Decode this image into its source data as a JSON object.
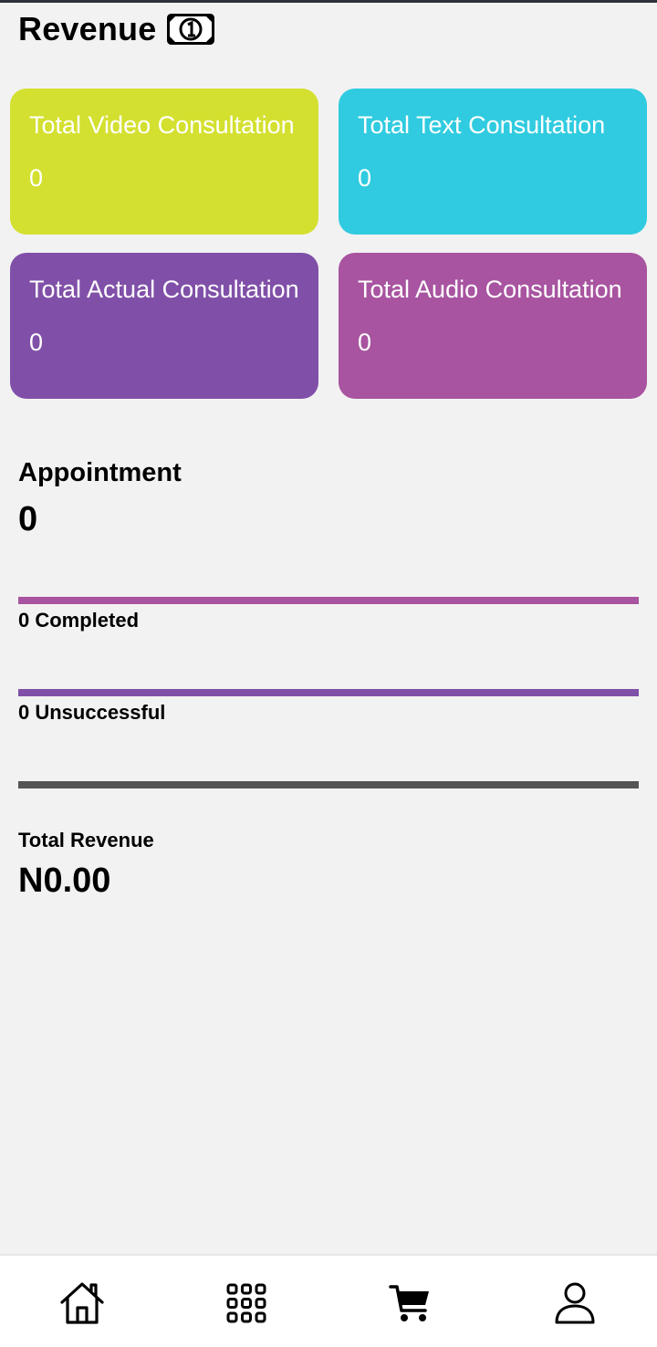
{
  "header": {
    "title": "Revenue",
    "icon": "money-bill-icon"
  },
  "cards": [
    {
      "title": "Total Video Consultation",
      "value": "0",
      "color": "#d4e030"
    },
    {
      "title": "Total Text Consultation",
      "value": "0",
      "color": "#30cbe0"
    },
    {
      "title": "Total Actual Consultation",
      "value": "0",
      "color": "#8050a8"
    },
    {
      "title": "Total Audio Consultation",
      "value": "0",
      "color": "#a854a0"
    }
  ],
  "appointment": {
    "label": "Appointment",
    "value": "0"
  },
  "completed": {
    "label": "0 Completed",
    "color": "#a854a0"
  },
  "unsuccessful": {
    "label": "0 Unsuccessful",
    "color": "#8050a8"
  },
  "divider_color": "#555555",
  "revenue": {
    "label": "Total Revenue",
    "value": "N0.00"
  },
  "bottom_nav": [
    {
      "icon": "home-icon"
    },
    {
      "icon": "apps-grid-icon"
    },
    {
      "icon": "cart-icon"
    },
    {
      "icon": "profile-icon"
    }
  ]
}
